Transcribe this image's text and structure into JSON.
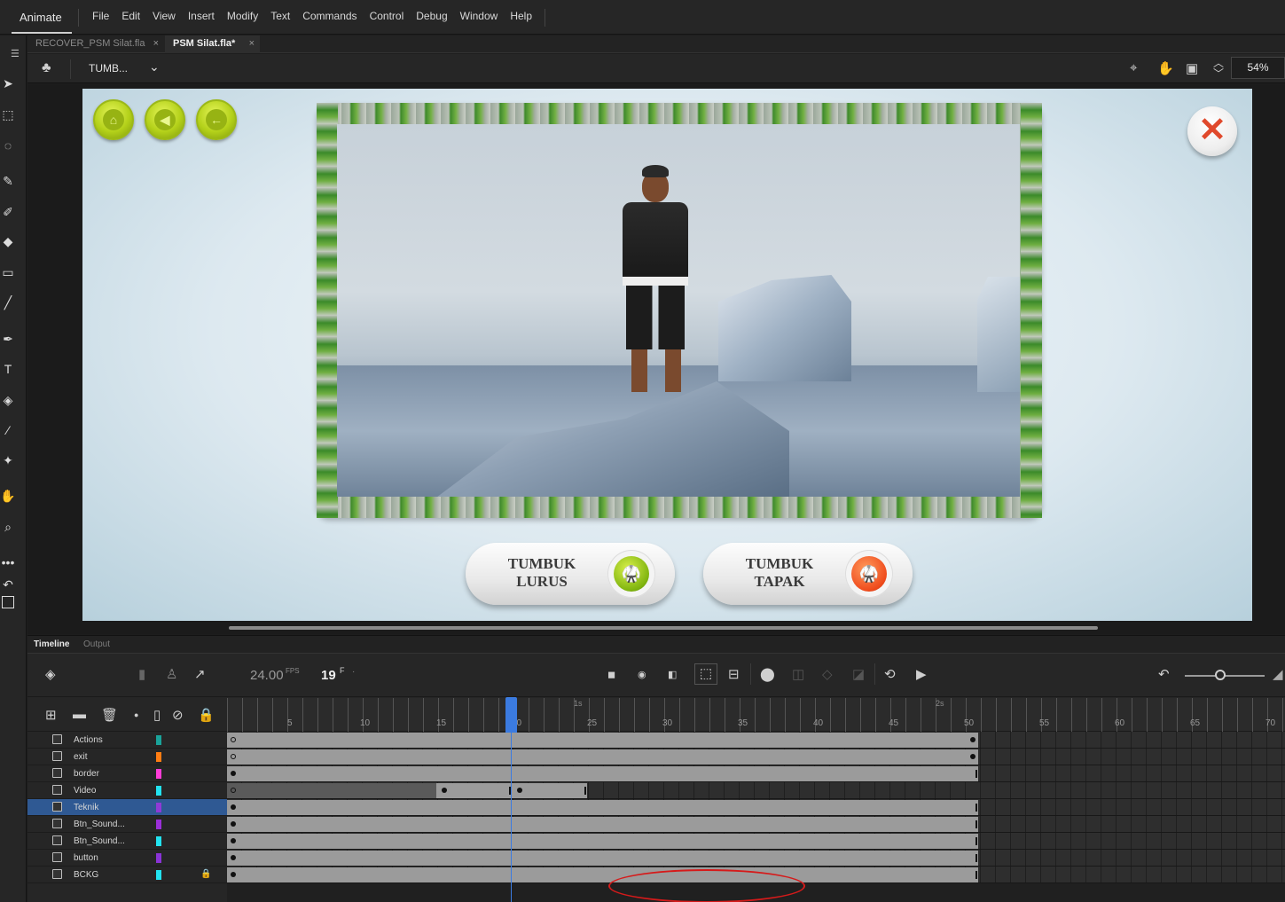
{
  "app": {
    "name": "Animate"
  },
  "menu": [
    "File",
    "Edit",
    "View",
    "Insert",
    "Modify",
    "Text",
    "Commands",
    "Control",
    "Debug",
    "Window",
    "Help"
  ],
  "doc_tabs": [
    {
      "label": "RECOVER_PSM Silat.fla",
      "active": false
    },
    {
      "label": "PSM Silat.fla*",
      "active": true
    }
  ],
  "tab_close": "×",
  "editbar": {
    "symbol": "TUMB...",
    "zoom": "54%"
  },
  "stage": {
    "top_buttons": [
      "home-icon",
      "sound-icon",
      "back-arrow-icon"
    ],
    "options": [
      {
        "label": "TUMBUK\nLURUS",
        "color": "#7fb40f"
      },
      {
        "label": "TUMBUK\nTAPAK",
        "color": "#ef4b1c"
      }
    ]
  },
  "timeline": {
    "tabs": [
      "Timeline",
      "Output"
    ],
    "fps": "24.00",
    "fps_unit": "FPS",
    "current_frame": "19",
    "frame_unit": "F",
    "current_frame_index": 19,
    "ruler_numbers": [
      "5",
      "10",
      "15",
      "20",
      "25",
      "30",
      "35",
      "40",
      "45",
      "50",
      "55",
      "60",
      "65",
      "70"
    ],
    "ruler_seconds": [
      "1s",
      "2s"
    ],
    "layers": [
      {
        "name": "Actions",
        "color": "#1aa39a",
        "selected": false,
        "locked": false
      },
      {
        "name": "exit",
        "color": "#ff7d12",
        "selected": false,
        "locked": false
      },
      {
        "name": "border",
        "color": "#ff3cd7",
        "selected": false,
        "locked": false
      },
      {
        "name": "Video",
        "color": "#22e3f0",
        "selected": false,
        "locked": false
      },
      {
        "name": "Teknik",
        "color": "#8f3ad6",
        "selected": true,
        "locked": false
      },
      {
        "name": "Btn_Sound...",
        "color": "#9a2fd8",
        "selected": false,
        "locked": false
      },
      {
        "name": "Btn_Sound...",
        "color": "#22e3f0",
        "selected": false,
        "locked": false
      },
      {
        "name": "button",
        "color": "#8a33d6",
        "selected": false,
        "locked": false
      },
      {
        "name": "BCKG",
        "color": "#22e3f0",
        "selected": false,
        "locked": true
      }
    ]
  },
  "colors": {
    "accent": "#3b7be0",
    "selection": "#2f5993",
    "annotation": "#d61a1a"
  }
}
